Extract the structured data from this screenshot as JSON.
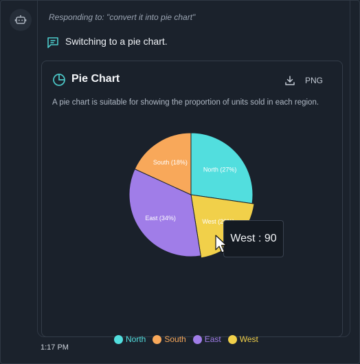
{
  "responding": "Responding to: \"convert it into pie chart\"",
  "message": "Switching to a pie chart.",
  "card": {
    "title": "Pie Chart",
    "export_label": "PNG",
    "description": "A pie chart is suitable for showing the proportion of units sold in each region."
  },
  "tooltip": "West : 90",
  "timestamp": "1:17 PM",
  "colors": {
    "accent": "#4cc9c9",
    "north": "#52dede",
    "south": "#f8a85a",
    "east": "#a07de8",
    "west": "#f1d04a"
  },
  "icons": {
    "avatar": "bot-icon",
    "message": "chat-lines-icon",
    "title": "pie-chart-icon",
    "export": "download-icon"
  },
  "chart_data": {
    "type": "pie",
    "categories": [
      "North",
      "South",
      "East",
      "West"
    ],
    "values": [
      27,
      18,
      34,
      20
    ],
    "slice_labels": [
      "North (27%)",
      "South (18%)",
      "East (34%)",
      "West (20%)"
    ],
    "highlighted": "West",
    "legend_position": "bottom"
  }
}
